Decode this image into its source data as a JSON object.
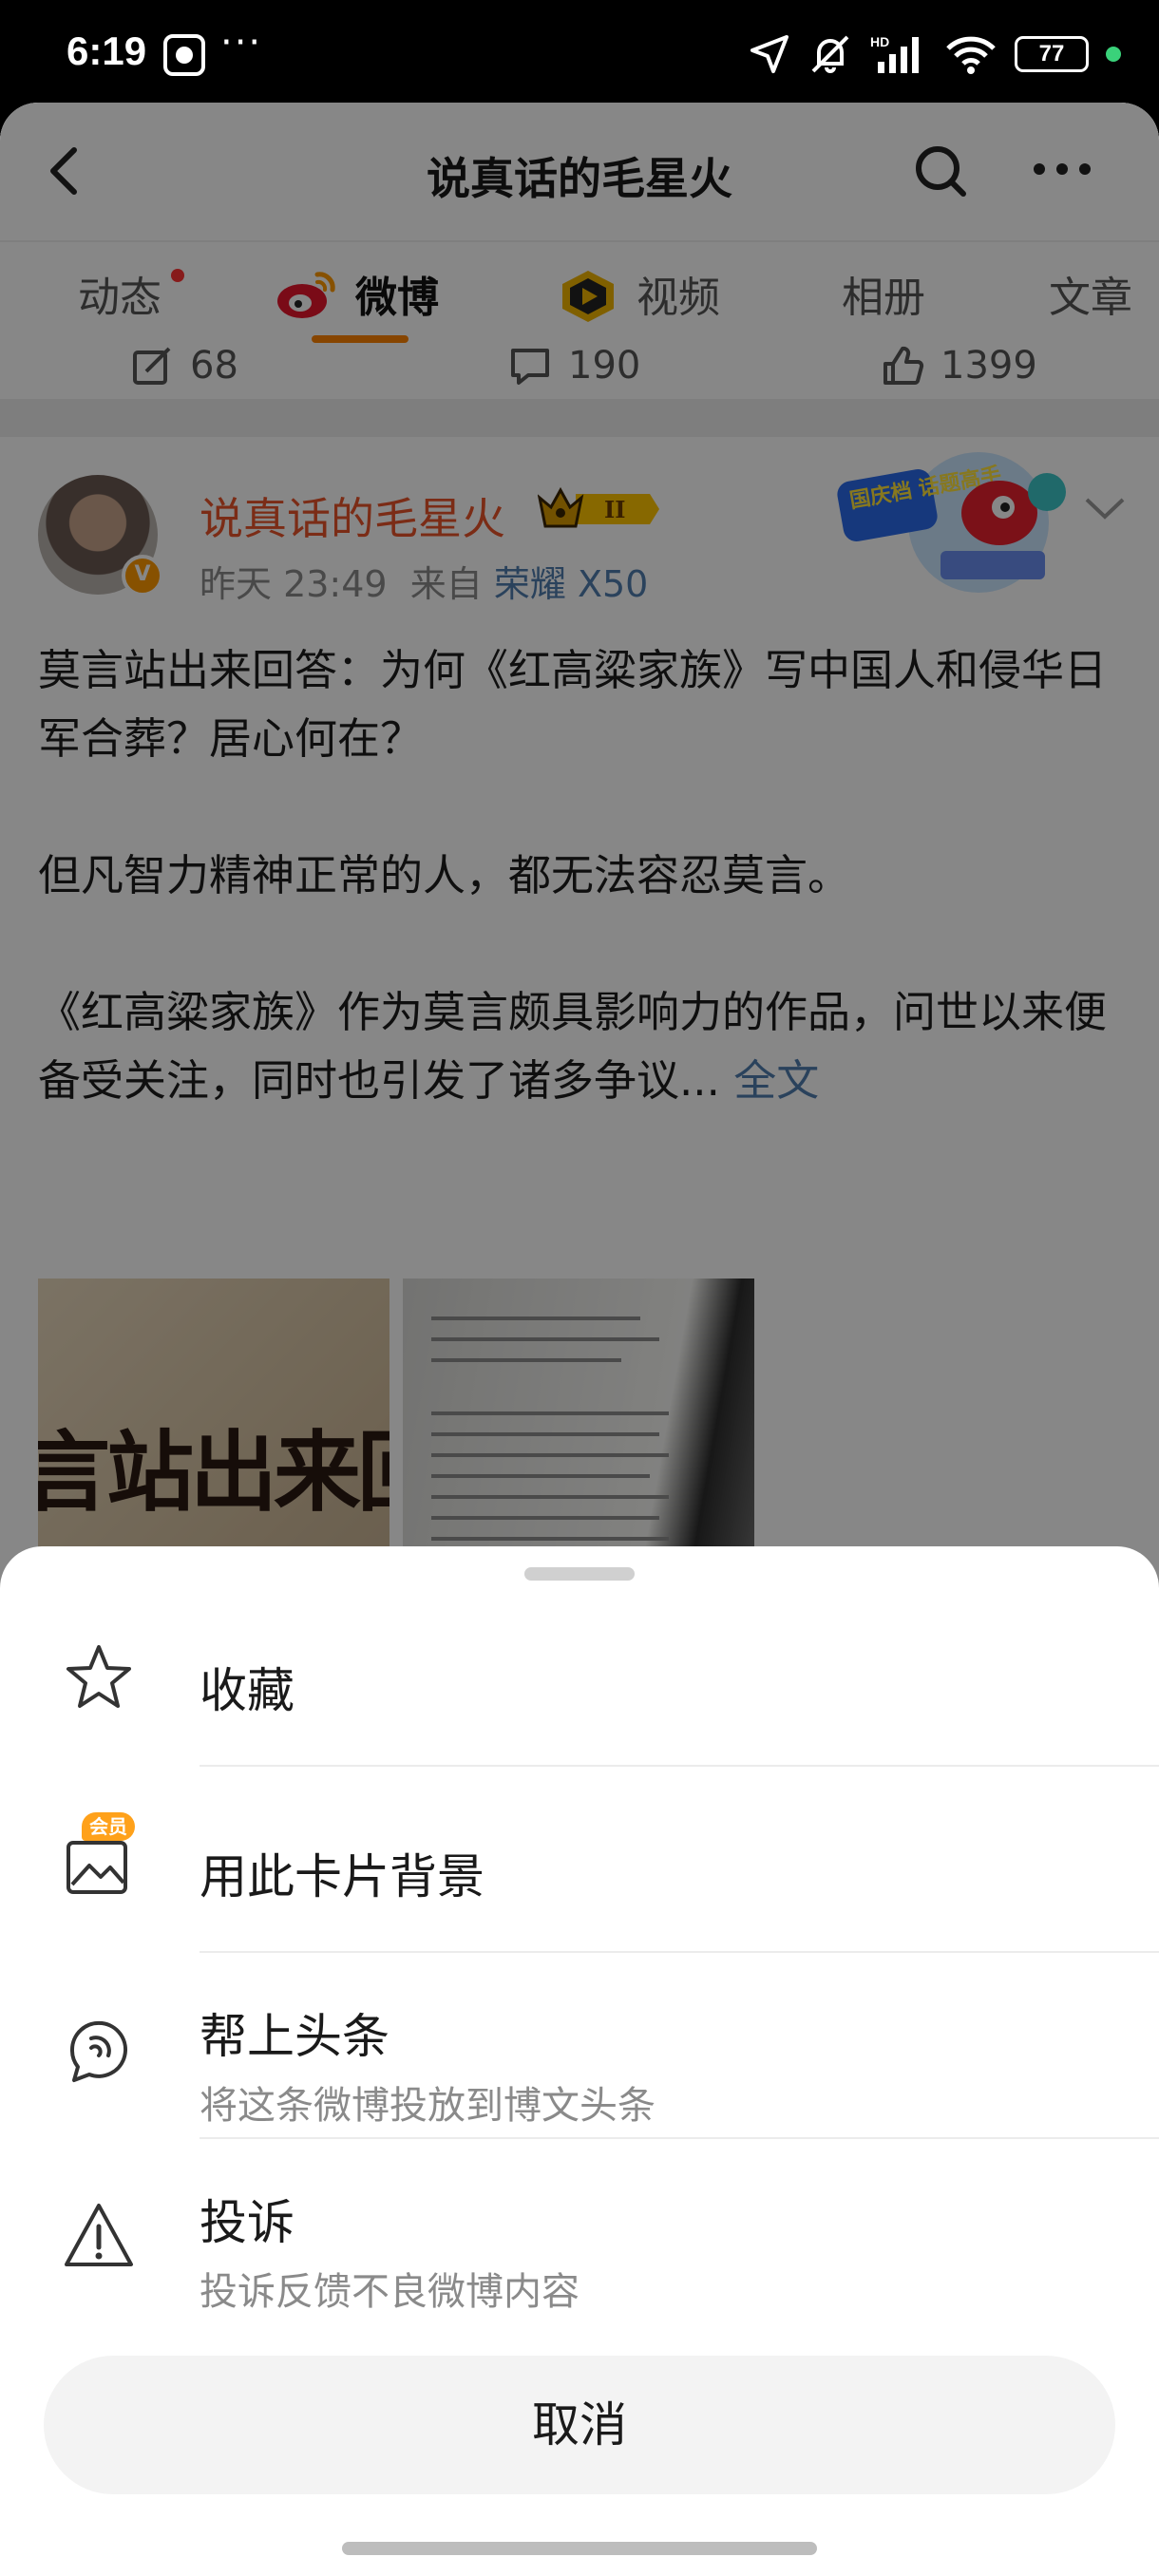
{
  "status_bar": {
    "time": "6:19",
    "dots": "···",
    "battery": "77",
    "icons": [
      "clock-icon",
      "location-icon",
      "mute-bell-icon",
      "hd-signal-icon",
      "wifi-icon",
      "battery-icon",
      "green-dot-indicator"
    ]
  },
  "header": {
    "title": "说真话的毛星火",
    "icons": [
      "back-icon",
      "search-icon",
      "more-icon"
    ]
  },
  "tabs": [
    {
      "label": "动态",
      "has_dot": true
    },
    {
      "label": "微博",
      "active": true
    },
    {
      "label": "视频"
    },
    {
      "label": "相册"
    },
    {
      "label": "文章"
    }
  ],
  "stats": {
    "reposts": "68",
    "comments": "190",
    "likes": "1399"
  },
  "post": {
    "author": "说真话的毛星火",
    "badge_level": "II",
    "time": "昨天 23:49",
    "from_label": "来自",
    "device": "荣耀 X50",
    "promo_text": "国庆档 话题高手",
    "paragraphs": [
      "莫言站出来回答：为何《红高粱家族》写中国人和侵华日军合葬？居心何在？",
      "但凡智力精神正常的人，都无法容忍莫言。",
      "《红高粱家族》作为莫言颇具影响力的作品，问世以来便备受关注，同时也引发了诸多争议..."
    ],
    "full_text_link": "全文",
    "image1_text": "言站出来回"
  },
  "sheet": {
    "items": [
      {
        "title": "收藏",
        "icon": "star-icon"
      },
      {
        "title": "用此卡片背景",
        "icon": "image-icon",
        "badge": "会员"
      },
      {
        "title": "帮上头条",
        "subtitle": "将这条微博投放到博文头条",
        "icon": "headline-icon"
      },
      {
        "title": "投诉",
        "subtitle": "投诉反馈不良微博内容",
        "icon": "warning-icon"
      }
    ],
    "cancel": "取消"
  },
  "colors": {
    "accent": "#ff8200",
    "author": "#e8542a",
    "link": "#507daf",
    "overlay": "rgba(0,0,0,0.47)"
  }
}
